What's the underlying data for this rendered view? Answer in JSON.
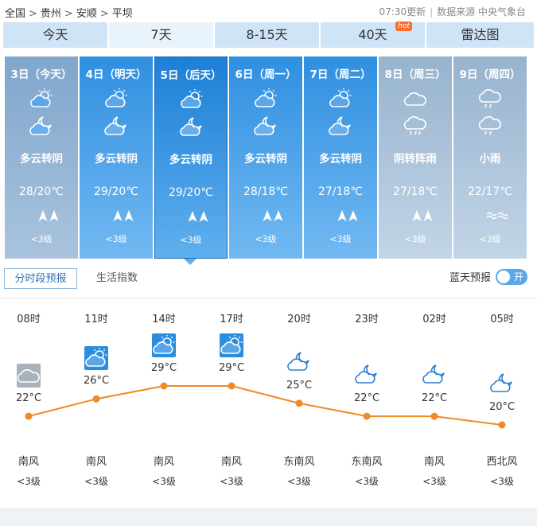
{
  "breadcrumb": [
    "全国",
    "贵州",
    "安顺",
    "平坝"
  ],
  "meta": {
    "update": "07:30更新",
    "source": "数据来源 中央气象台"
  },
  "tabs": [
    {
      "label": "今天"
    },
    {
      "label": "7天",
      "active": true
    },
    {
      "label": "8-15天"
    },
    {
      "label": "40天",
      "badge": "hot"
    },
    {
      "label": "雷达图"
    }
  ],
  "days": [
    {
      "date": "3日（今天）",
      "weather": "多云转阴",
      "temp": "28/20℃",
      "wind_level": "<3级",
      "style": "past",
      "icons": [
        "partly-cloudy-day",
        "partly-cloudy-night"
      ],
      "wind_dirs": [
        "north-wind",
        "north-wind"
      ]
    },
    {
      "date": "4日（明天）",
      "weather": "多云转阴",
      "temp": "29/20℃",
      "wind_level": "<3级",
      "style": "blue",
      "icons": [
        "partly-cloudy-day",
        "partly-cloudy-night"
      ],
      "wind_dirs": [
        "north-wind",
        "north-wind"
      ]
    },
    {
      "date": "5日（后天）",
      "weather": "多云转阴",
      "temp": "29/20℃",
      "wind_level": "<3级",
      "style": "sel",
      "icons": [
        "partly-cloudy-day",
        "partly-cloudy-night"
      ],
      "wind_dirs": [
        "north-wind",
        "north-wind"
      ]
    },
    {
      "date": "6日（周一）",
      "weather": "多云转阴",
      "temp": "28/18℃",
      "wind_level": "<3级",
      "style": "blue",
      "icons": [
        "partly-cloudy-day",
        "partly-cloudy-night"
      ],
      "wind_dirs": [
        "north-wind",
        "north-wind"
      ]
    },
    {
      "date": "7日（周二）",
      "weather": "多云转阴",
      "temp": "27/18℃",
      "wind_level": "<3级",
      "style": "blue",
      "icons": [
        "partly-cloudy-day",
        "partly-cloudy-night"
      ],
      "wind_dirs": [
        "north-wind",
        "north-wind"
      ]
    },
    {
      "date": "8日（周三）",
      "weather": "阴转阵雨",
      "temp": "27/18℃",
      "wind_level": "<3级",
      "style": "gray",
      "icons": [
        "cloudy",
        "shower"
      ],
      "wind_dirs": [
        "north-wind",
        "north-wind"
      ]
    },
    {
      "date": "9日（周四）",
      "weather": "小雨",
      "temp": "22/17℃",
      "wind_level": "<3级",
      "style": "gray",
      "icons": [
        "light-rain",
        "light-rain"
      ],
      "wind_dirs": [
        "variable-wind",
        "variable-wind"
      ]
    }
  ],
  "subtabs": {
    "hourly": "分时段预报",
    "index": "生活指数"
  },
  "bluesky": {
    "label": "蓝天预报",
    "toggle": "开"
  },
  "hourly": [
    {
      "hour": "08时",
      "temp": "22°C",
      "value": 22,
      "icon": "cloudy",
      "icon_style": "gray-box",
      "wind": "南风",
      "level": "<3级"
    },
    {
      "hour": "11时",
      "temp": "26°C",
      "value": 26,
      "icon": "partly-cloudy-day",
      "icon_style": "blue-box",
      "wind": "南风",
      "level": "<3级"
    },
    {
      "hour": "14时",
      "temp": "29°C",
      "value": 29,
      "icon": "partly-cloudy-day",
      "icon_style": "blue-box",
      "wind": "南风",
      "level": "<3级"
    },
    {
      "hour": "17时",
      "temp": "29°C",
      "value": 29,
      "icon": "partly-cloudy-day",
      "icon_style": "blue-box",
      "wind": "南风",
      "level": "<3级"
    },
    {
      "hour": "20时",
      "temp": "25°C",
      "value": 25,
      "icon": "cloudy-night",
      "icon_style": "plain",
      "wind": "东南风",
      "level": "<3级"
    },
    {
      "hour": "23时",
      "temp": "22°C",
      "value": 22,
      "icon": "cloudy-night",
      "icon_style": "plain",
      "wind": "东南风",
      "level": "<3级"
    },
    {
      "hour": "02时",
      "temp": "22°C",
      "value": 22,
      "icon": "cloudy-night",
      "icon_style": "plain",
      "wind": "南风",
      "level": "<3级"
    },
    {
      "hour": "05时",
      "temp": "20°C",
      "value": 20,
      "icon": "cloudy-night",
      "icon_style": "plain",
      "wind": "西北风",
      "level": "<3级"
    }
  ],
  "colors": {
    "accent": "#1d7fd6",
    "line": "#f08a24",
    "tab_bg": "#cfe4f6",
    "hot": "#ff6d2d"
  }
}
